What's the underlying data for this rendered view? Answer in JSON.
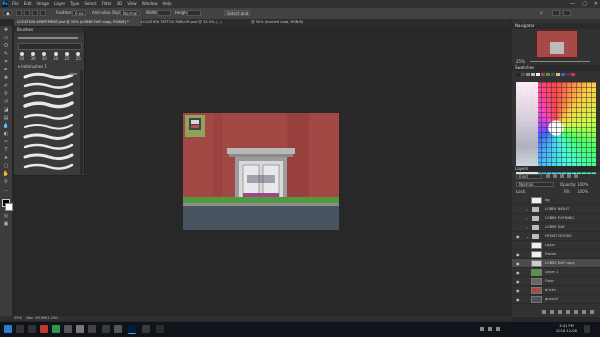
{
  "app": {
    "logo": "Ps"
  },
  "menu": [
    "File",
    "Edit",
    "Image",
    "Layer",
    "Type",
    "Select",
    "Filter",
    "3D",
    "View",
    "Window",
    "Help"
  ],
  "window_controls": {
    "minimize": "—",
    "maximize": "▢",
    "close": "✕"
  },
  "options": {
    "preset": "⬢",
    "mode_label": "Feather:",
    "feather": "0 px",
    "anti_alias": "Anti-alias",
    "style_label": "Style:",
    "style": "Normal",
    "width_label": "Width:",
    "height_label": "Height:",
    "select_mask": "Select and Mask..."
  },
  "tabs": [
    {
      "label": "LOCATION APARTMENT.psd @ 25% (LOBBY DAY copy, RGB/8) *",
      "active": true
    },
    {
      "label": "LOCATION TATTOO PARLOR.psd @ 33.3% (...)",
      "active": false
    },
    {
      "label": "@ 50% (burned road, RGB/8)",
      "active": false
    }
  ],
  "brushes": {
    "title": "Brushes",
    "group": "Inkbrushes 1",
    "sizes": [
      "30",
      "30",
      "30",
      "30",
      "25",
      "25"
    ]
  },
  "navigator": {
    "title": "Navigator",
    "zoom": "25%"
  },
  "swatches": {
    "title": "Swatches"
  },
  "layers": {
    "title": "Layers",
    "kind": "Kind",
    "blend": "Normal",
    "opacity_label": "Opacity:",
    "opacity": "100%",
    "lock_label": "Lock:",
    "fill_label": "Fill:",
    "fill": "100%",
    "items": [
      {
        "name": "bg",
        "type": "layer",
        "visible": false
      },
      {
        "name": "LOBBY NIGHT",
        "type": "folder",
        "visible": false
      },
      {
        "name": "LOBBY EVENING",
        "type": "folder",
        "visible": false
      },
      {
        "name": "LOBBY DAY",
        "type": "folder",
        "visible": false
      },
      {
        "name": "FRONT DOORS",
        "type": "folder",
        "visible": true
      },
      {
        "name": "Layer",
        "type": "layer",
        "visible": false
      },
      {
        "name": "Frame",
        "type": "layer",
        "visible": true
      },
      {
        "name": "LOBBY DAY copy",
        "type": "layer",
        "visible": true,
        "selected": true
      },
      {
        "name": "Layer 1",
        "type": "layer",
        "visible": true
      },
      {
        "name": "Floor",
        "type": "layer",
        "visible": true
      },
      {
        "name": "bricks",
        "type": "layer",
        "visible": true
      },
      {
        "name": "ground",
        "type": "layer",
        "visible": true
      }
    ]
  },
  "status": {
    "zoom": "25%",
    "doc": "Doc: 39.9M/1.25G"
  },
  "taskbar": {
    "time": "3:41 PM",
    "date": "2018-12-08"
  },
  "colors": {
    "accent": "#31a8ff",
    "brick": "#a64a48",
    "grass": "#4e9a3c",
    "road": "#4a5460"
  }
}
